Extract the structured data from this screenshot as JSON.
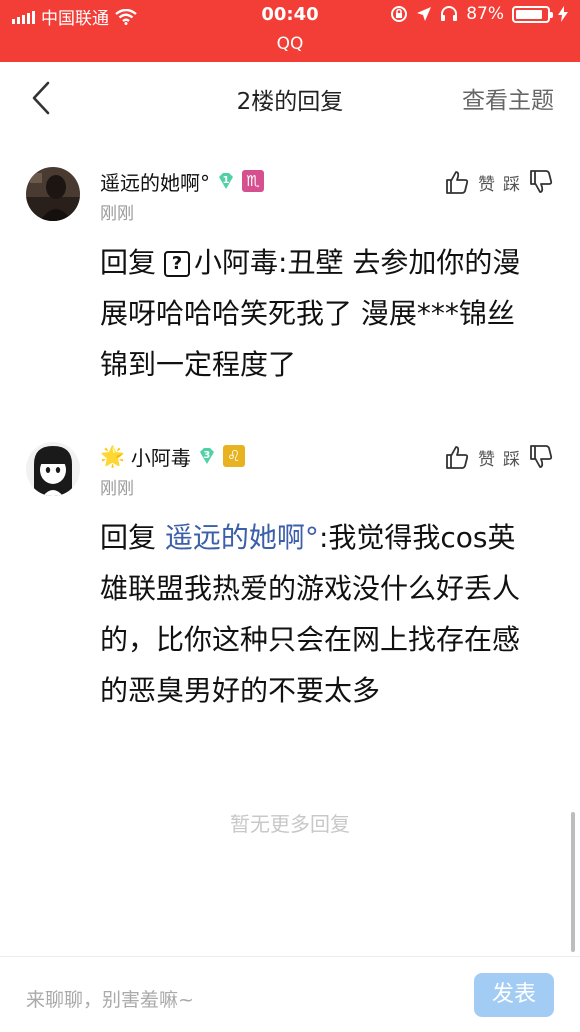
{
  "status": {
    "carrier": "中国联通",
    "time": "00:40",
    "battery": "87%",
    "battery_level": 0.87,
    "app": "QQ"
  },
  "nav": {
    "title": "2楼的回复",
    "view_topic": "查看主题"
  },
  "comments": [
    {
      "username": "遥远的她啊°",
      "level": "1",
      "zodiac": "♏",
      "zodiac_color": "#d64f8f",
      "time": "刚刚",
      "like_label": "赞",
      "dislike_label": "踩",
      "reply_prefix": "回复",
      "reply_to": "小阿毒",
      "content": ":丑壁 去参加你的漫展呀哈哈哈笑死我了 漫展***锦丝锦到一定程度了"
    },
    {
      "badge": "🌟",
      "username": "小阿毒",
      "level": "3",
      "zodiac": "♌",
      "zodiac_color": "#e7b320",
      "time": "刚刚",
      "like_label": "赞",
      "dislike_label": "踩",
      "reply_prefix": "回复",
      "reply_to": "遥远的她啊°",
      "content": ":我觉得我cos英雄联盟我热爱的游戏没什么好丢人的，比你这种只会在网上找存在感的恶臭男好的不要太多"
    }
  ],
  "footer": {
    "no_more": "暂无更多回复",
    "input_placeholder": "来聊聊，别害羞嘛~",
    "send_label": "发表"
  },
  "colors": {
    "status_bar": "#f23e37",
    "link": "#3b5fa8",
    "send_button": "#a3ccf4",
    "gem": "#4fd1a5"
  }
}
